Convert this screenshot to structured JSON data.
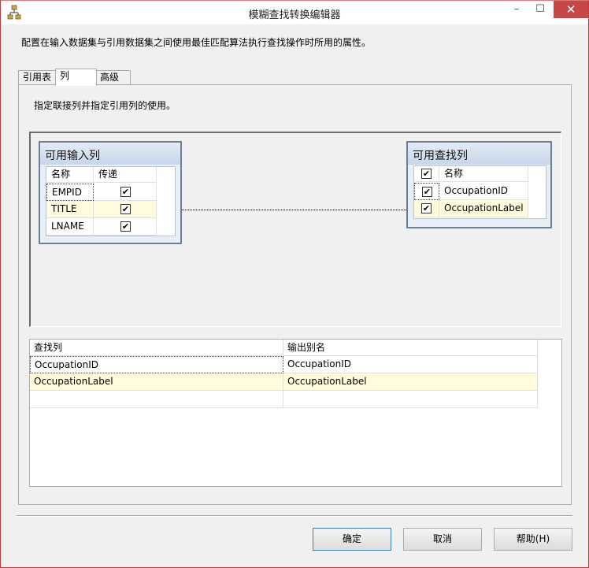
{
  "window": {
    "title": "模糊查找转换编辑器"
  },
  "description": "配置在输入数据集与引用数据集之间使用最佳匹配算法执行查找操作时所用的属性。",
  "tabs": [
    {
      "label": "引用表"
    },
    {
      "label": "列"
    },
    {
      "label": "高级"
    }
  ],
  "panel": {
    "hint": "指定联接列并指定引用列的使用。"
  },
  "input_box": {
    "title": "可用输入列",
    "headers": {
      "name": "名称",
      "pass": "传递"
    },
    "rows": [
      {
        "name": "EMPID",
        "checked": true
      },
      {
        "name": "TITLE",
        "checked": true
      },
      {
        "name": "LNAME",
        "checked": true
      }
    ]
  },
  "lookup_box": {
    "title": "可用查找列",
    "headers": {
      "name": "名称"
    },
    "rows": [
      {
        "name": "OccupationID",
        "checked": true
      },
      {
        "name": "OccupationLabel",
        "checked": true
      }
    ]
  },
  "mapping_table": {
    "headers": {
      "lookup": "查找列",
      "alias": "输出别名"
    },
    "rows": [
      {
        "lookup": "OccupationID",
        "alias": "OccupationID"
      },
      {
        "lookup": "OccupationLabel",
        "alias": "OccupationLabel"
      }
    ]
  },
  "buttons": {
    "ok": "确定",
    "cancel": "取消",
    "help": "帮助(H)"
  },
  "checkmark": "✔",
  "title_controls": {
    "minimize": "–",
    "maximize": "☐",
    "close": "✕"
  }
}
